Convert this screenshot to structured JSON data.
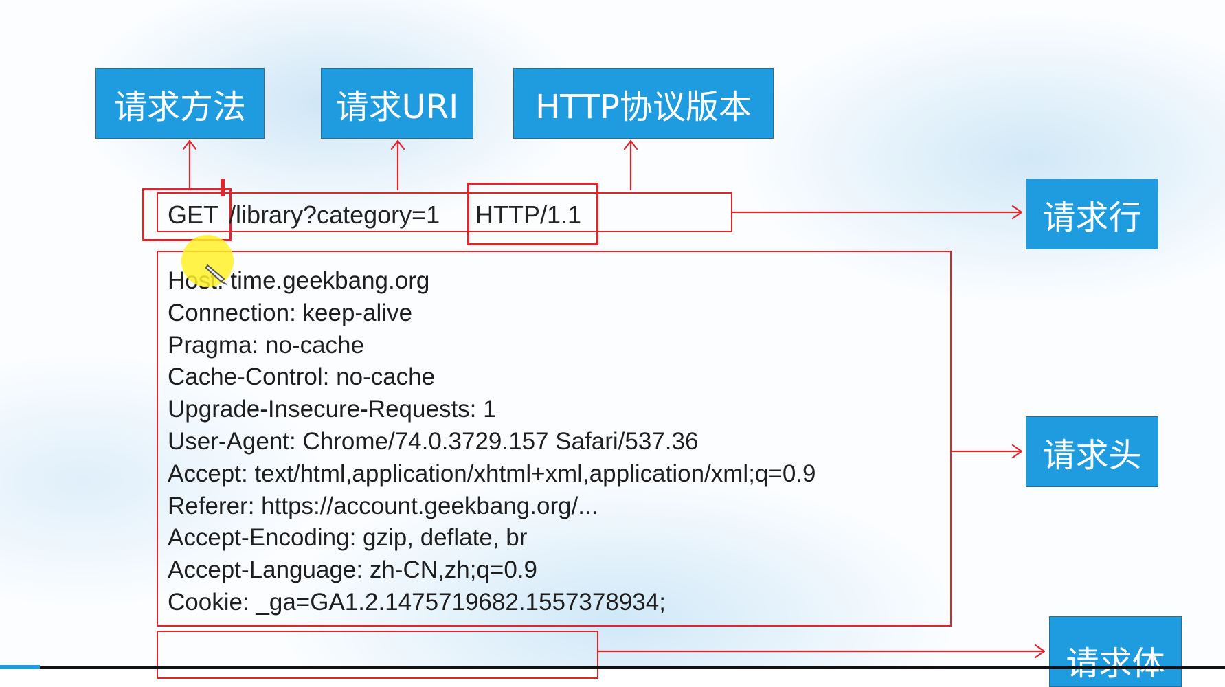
{
  "labels": {
    "method": "请求方法",
    "uri": "请求URI",
    "version": "HTTP协议版本",
    "request_line": "请求行",
    "request_headers": "请求头",
    "request_body": "请求体"
  },
  "request_line": {
    "method": "GET",
    "uri": "/library?category=1",
    "version": "HTTP/1.1"
  },
  "headers": [
    "Host: time.geekbang.org",
    "Connection: keep-alive",
    "Pragma: no-cache",
    "Cache-Control: no-cache",
    "Upgrade-Insecure-Requests: 1",
    "User-Agent: Chrome/74.0.3729.157 Safari/537.36",
    "Accept: text/html,application/xhtml+xml,application/xml;q=0.9",
    "Referer: https://account.geekbang.org/...",
    "Accept-Encoding: gzip, deflate, br",
    "Accept-Language: zh-CN,zh;q=0.9",
    "Cookie: _ga=GA1.2.1475719682.1557378934;"
  ],
  "colors": {
    "label_blue": "#1f9be0",
    "annotation_red": "#e2242b"
  }
}
